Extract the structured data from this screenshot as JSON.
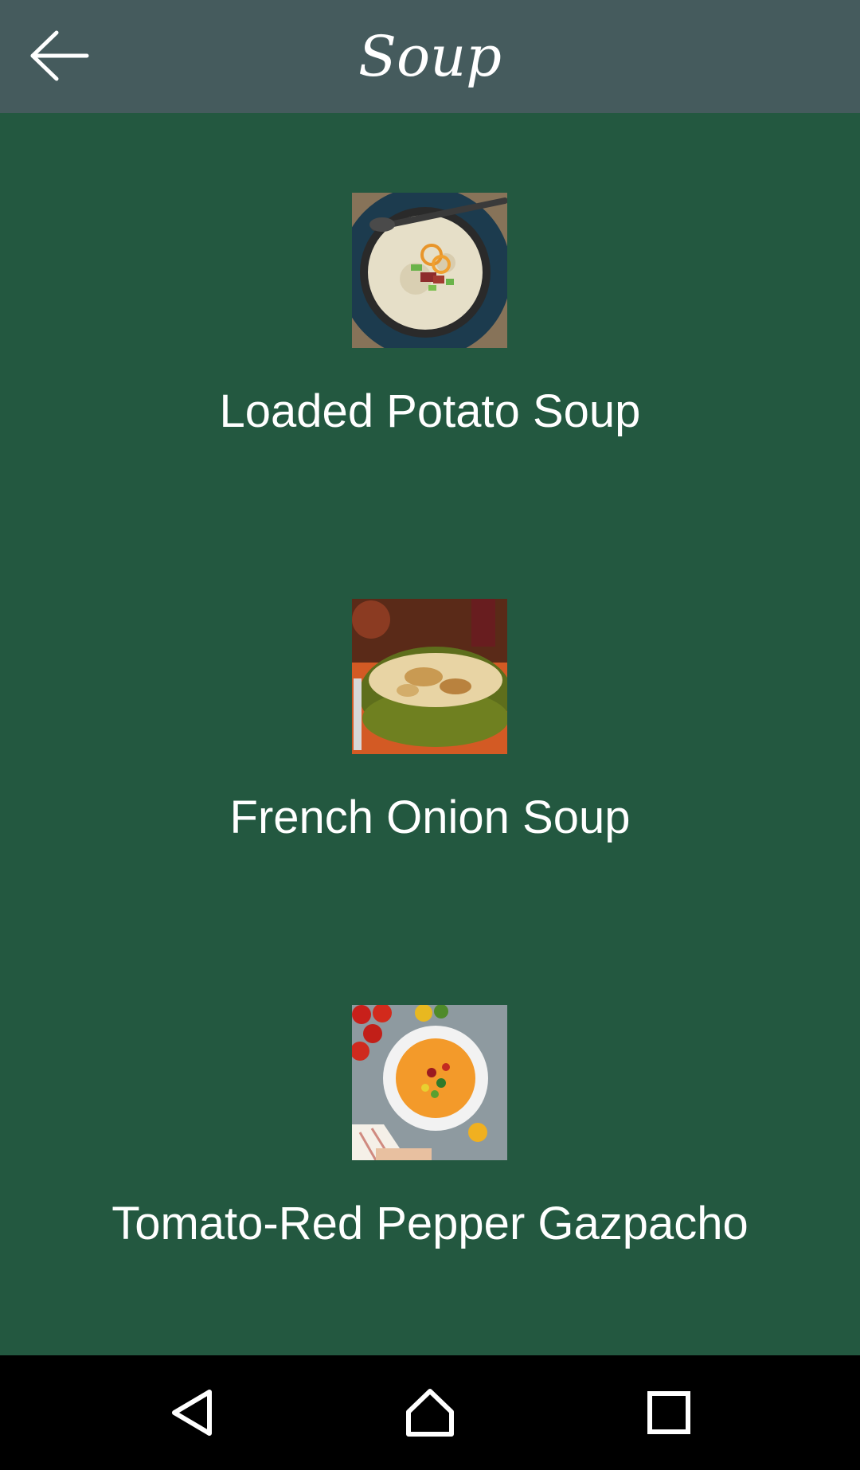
{
  "app_bar": {
    "title": "Soup",
    "back_icon": "arrow-left-icon"
  },
  "recipes": [
    {
      "name": "Loaded Potato Soup",
      "image": "loaded-potato-soup-photo"
    },
    {
      "name": "French Onion Soup",
      "image": "french-onion-soup-photo"
    },
    {
      "name": "Tomato-Red Pepper Gazpacho",
      "image": "tomato-red-pepper-gazpacho-photo"
    }
  ],
  "nav_bar": {
    "back_icon": "nav-back-icon",
    "home_icon": "nav-home-icon",
    "recents_icon": "nav-recents-icon"
  },
  "colors": {
    "app_bar": "#455b5d",
    "background": "#235840",
    "nav_bar": "#000000",
    "text": "#ffffff"
  }
}
